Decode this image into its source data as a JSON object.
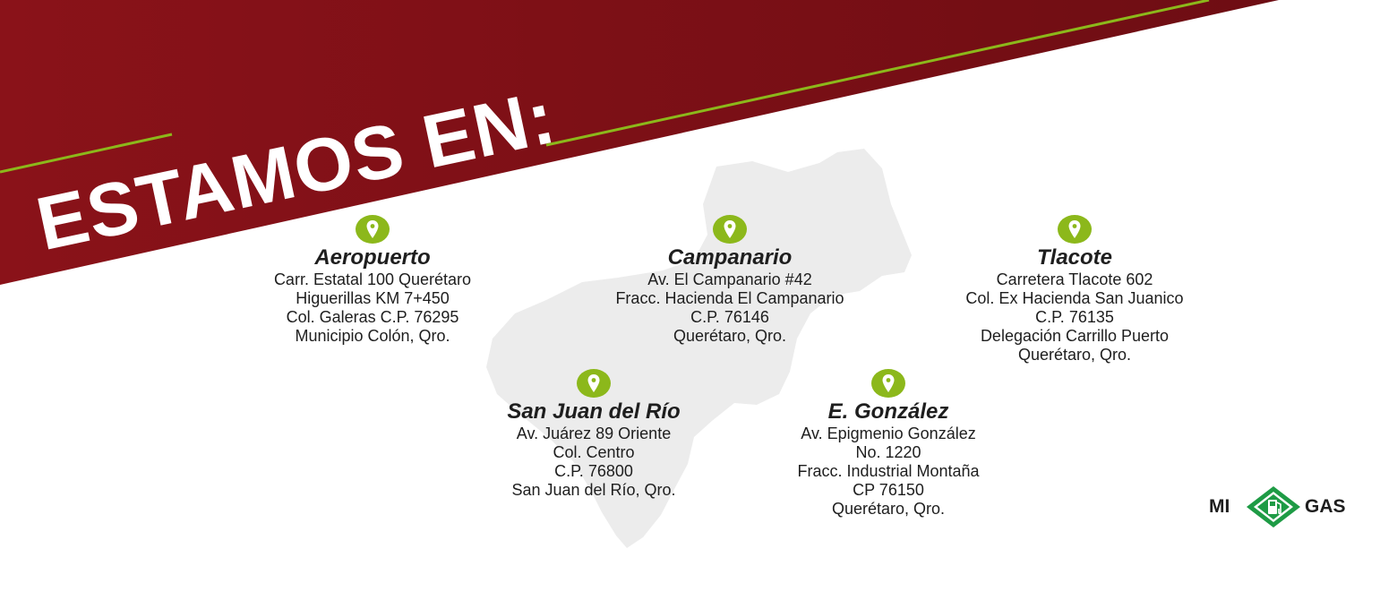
{
  "headline": "ESTAMOS EN:",
  "colors": {
    "banner_red": "#7b1016",
    "accent_green": "#8cb81b",
    "map_gray": "#ececec",
    "logo_green": "#1e9b45",
    "text": "#1e1e1e"
  },
  "locations": [
    {
      "icon": "map-pin-icon",
      "name": "Aeropuerto",
      "lines": [
        "Carr. Estatal 100 Querétaro",
        "Higuerillas KM 7+450",
        "Col. Galeras C.P. 76295",
        "Municipio Colón, Qro."
      ]
    },
    {
      "icon": "map-pin-icon",
      "name": "Campanario",
      "lines": [
        "Av. El Campanario #42",
        "Fracc. Hacienda El Campanario",
        "C.P. 76146",
        "Querétaro, Qro."
      ]
    },
    {
      "icon": "map-pin-icon",
      "name": "Tlacote",
      "lines": [
        "Carretera Tlacote 602",
        "Col. Ex Hacienda San Juanico",
        "C.P. 76135",
        "Delegación Carrillo Puerto",
        "Querétaro, Qro."
      ]
    },
    {
      "icon": "map-pin-icon",
      "name": "San Juan del Río",
      "lines": [
        "Av. Juárez 89 Oriente",
        "Col. Centro",
        "C.P. 76800",
        "San Juan del Río, Qro."
      ]
    },
    {
      "icon": "map-pin-icon",
      "name": "E. González",
      "lines": [
        "Av. Epigmenio González",
        "No. 1220",
        "Fracc. Industrial Montaña",
        "CP 76150",
        "Querétaro, Qro."
      ]
    }
  ],
  "logo": {
    "left": "MI",
    "right": "GAS",
    "icon": "fuel-pump-icon"
  }
}
